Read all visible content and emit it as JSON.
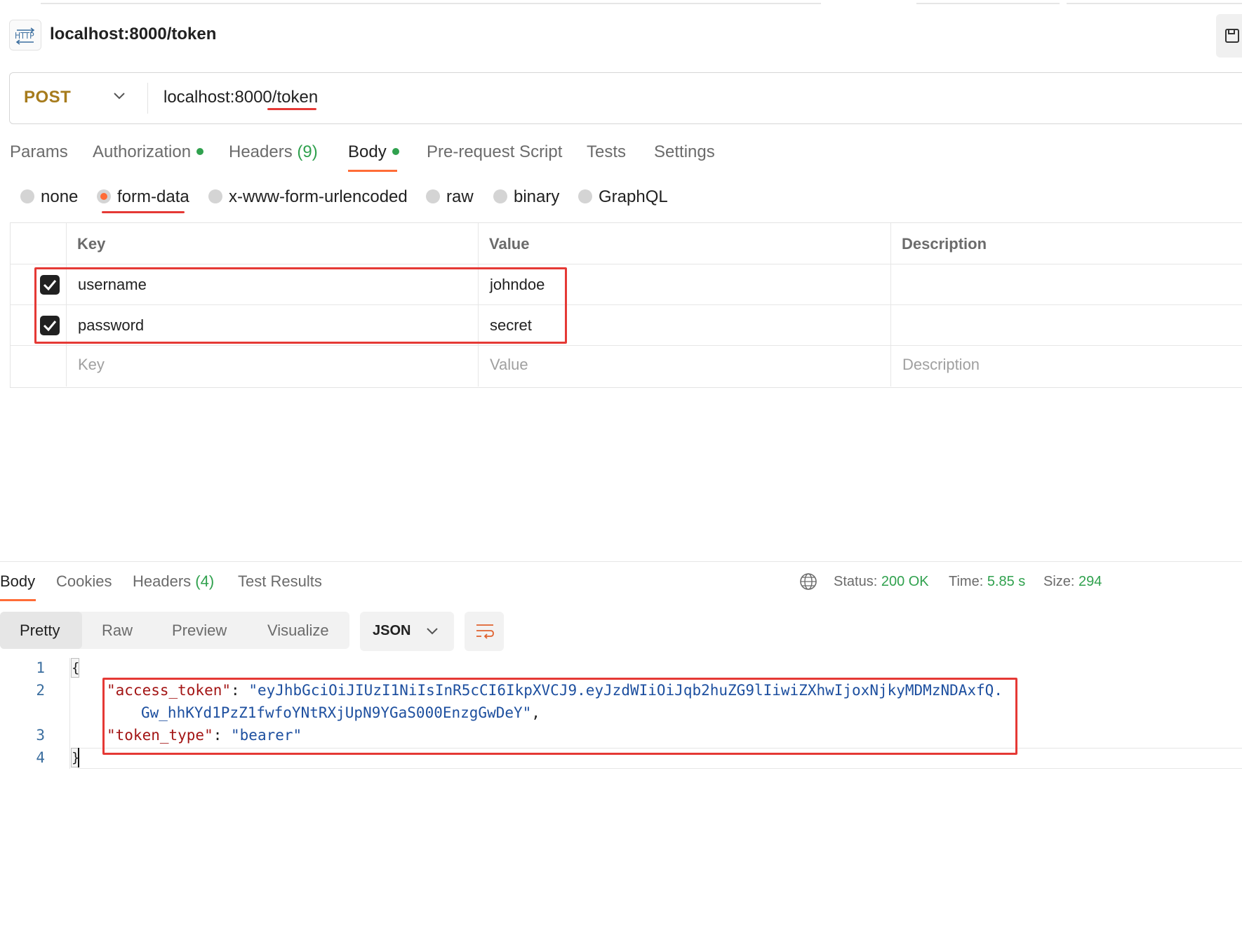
{
  "request": {
    "title": "localhost:8000/token",
    "icon": "http-icon",
    "method": "POST",
    "url": "localhost:8000/token"
  },
  "request_tabs": [
    {
      "label": "Params"
    },
    {
      "label": "Authorization"
    },
    {
      "label": "Headers",
      "count": "(9)"
    },
    {
      "label": "Body"
    },
    {
      "label": "Pre-request Script"
    },
    {
      "label": "Tests"
    },
    {
      "label": "Settings"
    }
  ],
  "body_types": [
    {
      "label": "none"
    },
    {
      "label": "form-data",
      "selected": true
    },
    {
      "label": "x-www-form-urlencoded"
    },
    {
      "label": "raw"
    },
    {
      "label": "binary"
    },
    {
      "label": "GraphQL"
    }
  ],
  "table": {
    "headers": {
      "key": "Key",
      "value": "Value",
      "description": "Description"
    },
    "rows": [
      {
        "key": "username",
        "value": "johndoe",
        "checked": true
      },
      {
        "key": "password",
        "value": "secret",
        "checked": true
      }
    ],
    "placeholders": {
      "key": "Key",
      "value": "Value",
      "description": "Description"
    }
  },
  "response_tabs": [
    {
      "label": "Body"
    },
    {
      "label": "Cookies"
    },
    {
      "label": "Headers",
      "count": "(4)"
    },
    {
      "label": "Test Results"
    }
  ],
  "status": {
    "status_label": "Status:",
    "status_value": "200 OK",
    "time_label": "Time:",
    "time_value": "5.85 s",
    "size_label": "Size:",
    "size_value": "294"
  },
  "view_modes": [
    "Pretty",
    "Raw",
    "Preview",
    "Visualize"
  ],
  "format": "JSON",
  "code": {
    "line_numbers": [
      "1",
      "2",
      "3",
      "4"
    ],
    "open_brace": "{",
    "close_brace": "}",
    "l2_key": "\"access_token\"",
    "l2_sep": ": ",
    "l2_val_a": "\"eyJhbGciOiJIUzI1NiIsInR5cCI6IkpXVCJ9.eyJzdWIiOiJqb2huZG9lIiwiZXhwIjoxNjkyMDMzNDAxfQ.",
    "l2_val_b": "Gw_hhKYd1PzZ1fwfoYNtRXjUpN9YGaS000EnzgGwDeY\"",
    "l2_comma": ",",
    "l3_key": "\"token_type\"",
    "l3_sep": ": ",
    "l3_val": "\"bearer\""
  },
  "colors": {
    "accent": "#ff6c37",
    "method": "#a67b1c",
    "success": "#30a14e",
    "highlight": "#e53935"
  }
}
